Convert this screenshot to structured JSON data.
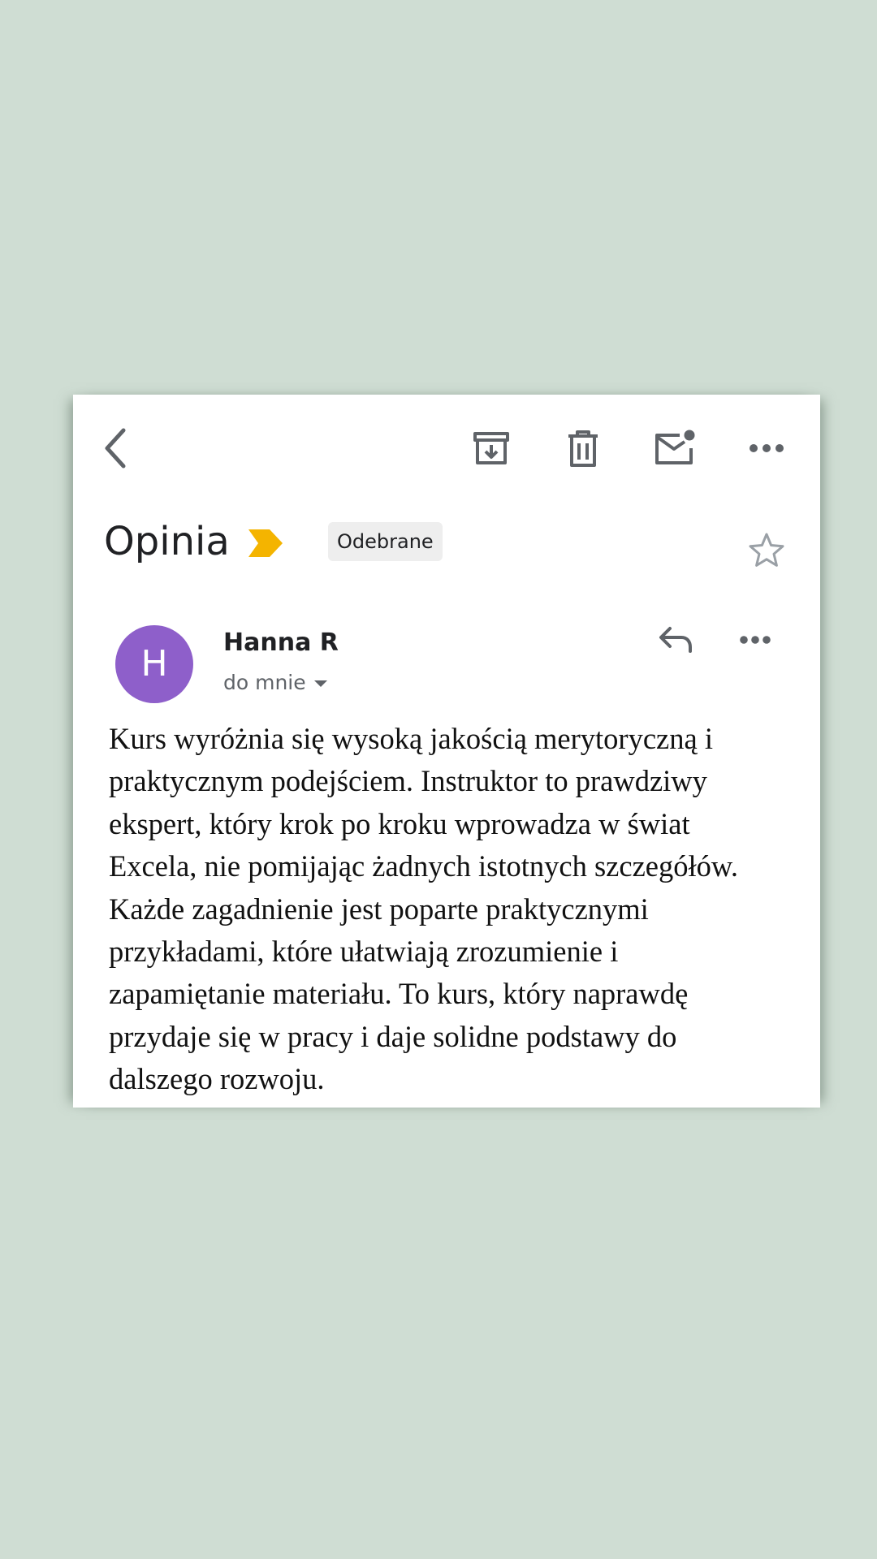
{
  "toolbar": {
    "back_icon": "chevron-left-icon",
    "archive_icon": "archive-icon",
    "delete_icon": "trash-icon",
    "unread_icon": "mail-unread-icon",
    "more_icon": "more-horizontal-icon"
  },
  "email": {
    "subject": "Opinia",
    "label": "Odebrane",
    "importance_color": "#f4b400",
    "starred": false,
    "sender": {
      "initial": "H",
      "name": "Hanna R",
      "avatar_color": "#8e5fca"
    },
    "recipient": "do mnie",
    "body_lines": [
      "Kurs wyróżnia się wysoką jakością merytoryczną i",
      "praktycznym podejściem. Instruktor to prawdziwy",
      "ekspert, który krok po kroku wprowadza w świat",
      "Excela, nie pomijając żadnych istotnych szczegółów.",
      "Każde zagadnienie jest poparte praktycznymi",
      "przykładami, które ułatwiają zrozumienie i",
      "zapamiętanie materiału. To kurs, który naprawdę",
      "przydaje się w pracy i daje solidne podstawy do",
      "dalszego rozwoju."
    ]
  },
  "colors": {
    "background": "#cfddd3",
    "card": "#ffffff",
    "icon": "#5f6368"
  }
}
